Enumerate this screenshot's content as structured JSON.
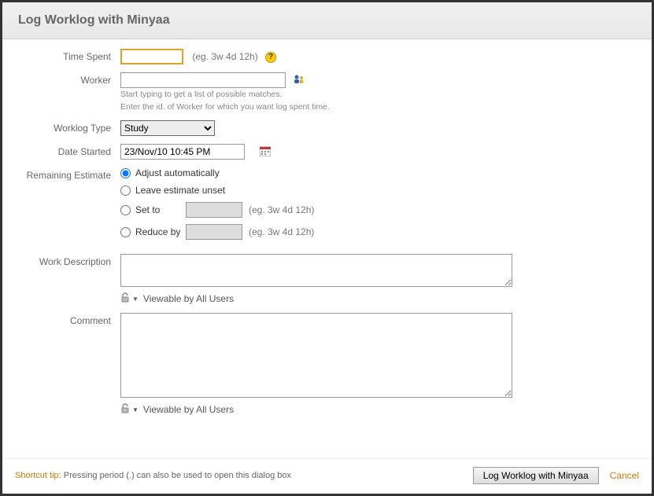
{
  "header": {
    "title": "Log Worklog with Minyaa"
  },
  "fields": {
    "timeSpent": {
      "label": "Time Spent",
      "value": "",
      "hint": "(eg. 3w 4d 12h)"
    },
    "worker": {
      "label": "Worker",
      "value": "",
      "hint1": "Start typing to get a list of possible matches.",
      "hint2": "Enter the id. of Worker for which you want log spent time."
    },
    "worklogType": {
      "label": "Worklog Type",
      "selected": "Study"
    },
    "dateStarted": {
      "label": "Date Started",
      "value": "23/Nov/10 10:45 PM"
    },
    "remaining": {
      "label": "Remaining Estimate",
      "opts": {
        "auto": "Adjust automatically",
        "leave": "Leave estimate unset",
        "setTo": "Set to",
        "reduceBy": "Reduce by"
      },
      "hint": "(eg. 3w 4d 12h)"
    },
    "workDesc": {
      "label": "Work Description"
    },
    "comment": {
      "label": "Comment"
    },
    "visibility": "Viewable by All Users"
  },
  "footer": {
    "shortcutLabel": "Shortcut tip",
    "shortcutText": ": Pressing period (.) can also be used to open this dialog box",
    "submit": "Log Worklog with Minyaa",
    "cancel": "Cancel"
  }
}
